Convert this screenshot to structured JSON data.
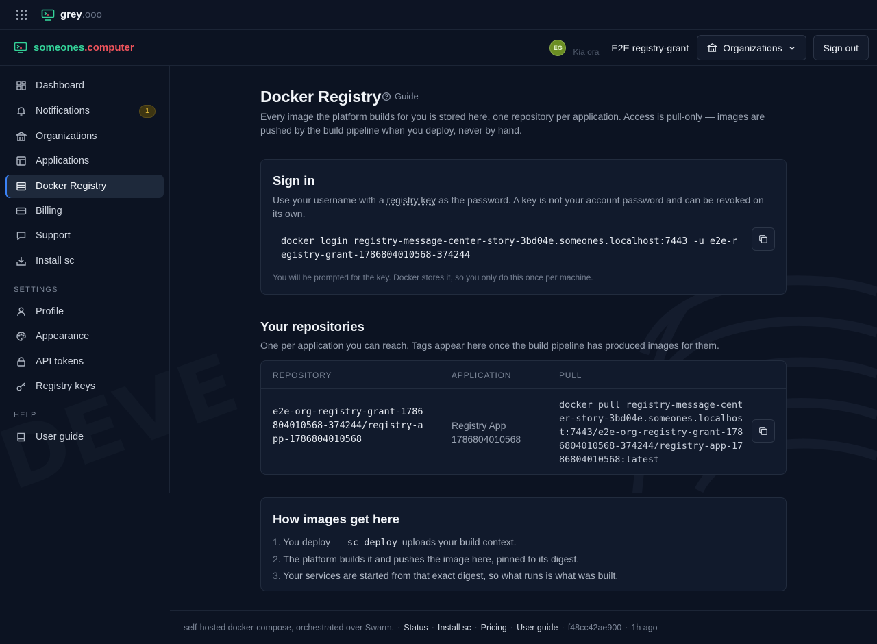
{
  "topbar": {
    "brand_primary": "grey",
    "brand_suffix": ".ooo"
  },
  "header": {
    "brand_primary": "someones",
    "brand_dot": ".",
    "brand_secondary": "computer",
    "avatar_initials": "EG",
    "greeting": "Kia ora",
    "user_name": "E2E registry-grant",
    "organizations_label": "Organizations",
    "sign_out_label": "Sign out"
  },
  "sidebar": {
    "items": [
      {
        "label": "Dashboard",
        "icon": "dashboard-icon"
      },
      {
        "label": "Notifications",
        "icon": "bell-icon",
        "badge": "1"
      },
      {
        "label": "Organizations",
        "icon": "building-icon"
      },
      {
        "label": "Applications",
        "icon": "layout-icon"
      },
      {
        "label": "Docker Registry",
        "icon": "server-icon",
        "active": true
      },
      {
        "label": "Billing",
        "icon": "credit-card-icon"
      },
      {
        "label": "Support",
        "icon": "message-icon"
      },
      {
        "label": "Install sc",
        "icon": "download-icon"
      }
    ],
    "settings_heading": "SETTINGS",
    "settings_items": [
      {
        "label": "Profile",
        "icon": "user-icon"
      },
      {
        "label": "Appearance",
        "icon": "palette-icon"
      },
      {
        "label": "API tokens",
        "icon": "lock-icon"
      },
      {
        "label": "Registry keys",
        "icon": "key-icon"
      }
    ],
    "help_heading": "HELP",
    "help_items": [
      {
        "label": "User guide",
        "icon": "book-icon"
      }
    ]
  },
  "main": {
    "title": "Docker Registry",
    "guide_label": "Guide",
    "description": "Every image the platform builds for you is stored here, one repository per application. Access is pull-only — images are pushed by the build pipeline when you deploy, never by hand.",
    "signin": {
      "title": "Sign in",
      "text_before": "Use your username with a ",
      "text_link": "registry key",
      "text_after": " as the password. A key is not your account password and can be revoked on its own.",
      "command": "docker login registry-message-center-story-3bd04e.someones.localhost:7443 -u e2e-registry-grant-1786804010568-374244",
      "hint": "You will be prompted for the key. Docker stores it, so you only do this once per machine."
    },
    "repositories": {
      "title": "Your repositories",
      "description": "One per application you can reach. Tags appear here once the build pipeline has produced images for them.",
      "columns": [
        "REPOSITORY",
        "APPLICATION",
        "PULL"
      ],
      "rows": [
        {
          "repository": "e2e-org-registry-grant-1786804010568-374244/registry-app-1786804010568",
          "application": "Registry App 1786804010568",
          "pull": "docker pull registry-message-center-story-3bd04e.someones.localhost:7443/e2e-org-registry-grant-1786804010568-374244/registry-app-1786804010568:latest"
        }
      ]
    },
    "howto": {
      "title": "How images get here",
      "steps": [
        {
          "num": "1.",
          "before": "You deploy — ",
          "code": "sc deploy",
          "after": " uploads your build context."
        },
        {
          "num": "2.",
          "before": "The platform builds it and pushes the image here, pinned to its digest.",
          "code": "",
          "after": ""
        },
        {
          "num": "3.",
          "before": "Your services are started from that exact digest, so what runs is what was built.",
          "code": "",
          "after": ""
        }
      ]
    }
  },
  "footer": {
    "text": "self-hosted docker-compose, orchestrated over Swarm.",
    "links": [
      "Status",
      "Install sc",
      "Pricing",
      "User guide"
    ],
    "commit": "f48cc42ae900",
    "age": "1h ago"
  },
  "colors": {
    "background": "#0c1322",
    "brand_green": "#34d399",
    "brand_red": "#f0545c",
    "badge_yellow": "#e2b93b",
    "active_accent": "#3b82f6"
  }
}
